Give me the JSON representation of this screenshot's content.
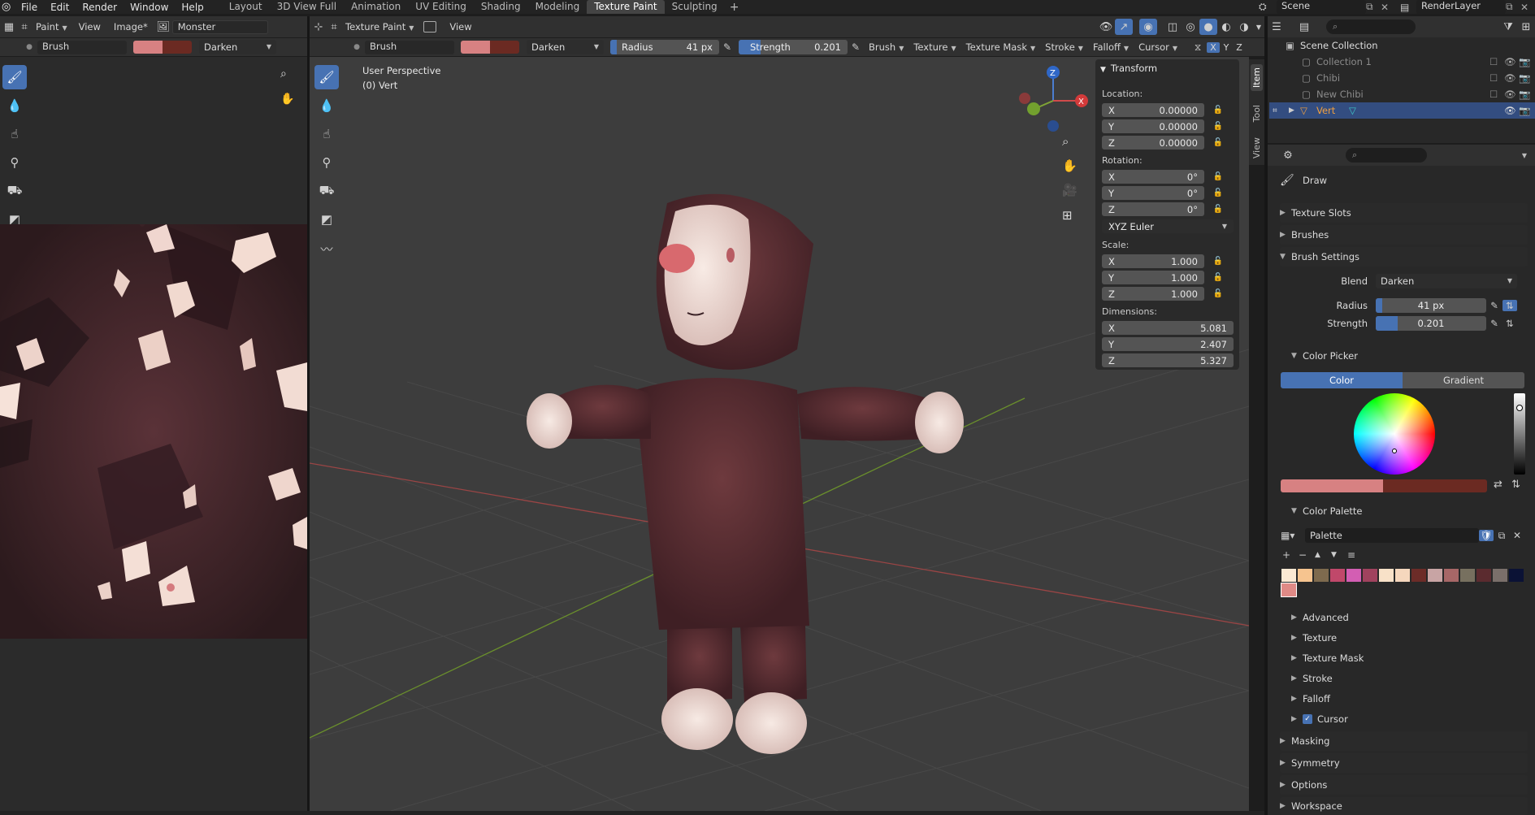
{
  "menus": [
    "File",
    "Edit",
    "Render",
    "Window",
    "Help"
  ],
  "workspaces": [
    "Layout",
    "3D View Full",
    "Animation",
    "UV Editing",
    "Shading",
    "Modeling",
    "Texture Paint",
    "Sculpting"
  ],
  "active_workspace": "Texture Paint",
  "scene_name": "Scene",
  "view_layer": "RenderLayer",
  "image_editor": {
    "mode": "Paint",
    "view_menu": "View",
    "image_menu": "Image*",
    "image_name": "Monster",
    "brush": "Brush",
    "blend": "Darken"
  },
  "viewport": {
    "mode": "Texture Paint",
    "view_menu": "View",
    "brush": "Brush",
    "blend": "Darken",
    "radius_label": "Radius",
    "radius_value": "41 px",
    "strength_label": "Strength",
    "strength_value": "0.201",
    "header_menus": [
      "Brush",
      "Texture",
      "Texture Mask",
      "Stroke",
      "Falloff",
      "Cursor"
    ],
    "axes": [
      "X",
      "Y",
      "Z"
    ],
    "perspective": "User Perspective",
    "object_info": "(0) Vert"
  },
  "colors": {
    "primary": "#d78182",
    "secondary": "#6b2a22",
    "accent": "#4772b3",
    "palette": [
      "#fbe9d3",
      "#f6c48f",
      "#7e6a4e",
      "#c0486a",
      "#d35eb3",
      "#a0425e",
      "#f8e1c8",
      "#f5d7bd",
      "#6c2c28",
      "#c8a4a4",
      "#a76767",
      "#77705f",
      "#5b2b2f",
      "#7a6f6a",
      "#0b1235",
      "#e08a86"
    ]
  },
  "transform": {
    "title": "Transform",
    "location_label": "Location:",
    "location": [
      {
        "axis": "X",
        "value": "0.00000"
      },
      {
        "axis": "Y",
        "value": "0.00000"
      },
      {
        "axis": "Z",
        "value": "0.00000"
      }
    ],
    "rotation_label": "Rotation:",
    "rotation": [
      {
        "axis": "X",
        "value": "0°"
      },
      {
        "axis": "Y",
        "value": "0°"
      },
      {
        "axis": "Z",
        "value": "0°"
      }
    ],
    "rotation_mode": "XYZ Euler",
    "scale_label": "Scale:",
    "scale": [
      {
        "axis": "X",
        "value": "1.000"
      },
      {
        "axis": "Y",
        "value": "1.000"
      },
      {
        "axis": "Z",
        "value": "1.000"
      }
    ],
    "dimensions_label": "Dimensions:",
    "dimensions": [
      {
        "axis": "X",
        "value": "5.081"
      },
      {
        "axis": "Y",
        "value": "2.407"
      },
      {
        "axis": "Z",
        "value": "5.327"
      }
    ]
  },
  "sidebar_tabs": [
    "Item",
    "Tool",
    "View"
  ],
  "outliner": {
    "items": [
      {
        "label": "Scene Collection"
      },
      {
        "label": "Collection 1"
      },
      {
        "label": "Chibi"
      },
      {
        "label": "New Chibi"
      },
      {
        "label": "Vert"
      }
    ]
  },
  "properties": {
    "tool_name": "Draw",
    "sections": [
      "Texture Slots",
      "Brushes",
      "Brush Settings"
    ],
    "blend_label": "Blend",
    "blend_value": "Darken",
    "radius_label": "Radius",
    "radius_value": "41 px",
    "strength_label": "Strength",
    "strength_value": "0.201",
    "color_picker_label": "Color Picker",
    "color_tab": "Color",
    "gradient_tab": "Gradient",
    "color_palette_label": "Color Palette",
    "palette_name": "Palette",
    "subsections": [
      "Advanced",
      "Texture",
      "Texture Mask",
      "Stroke",
      "Falloff",
      "Cursor"
    ],
    "bottom_sections": [
      "Masking",
      "Symmetry",
      "Options",
      "Workspace"
    ]
  }
}
